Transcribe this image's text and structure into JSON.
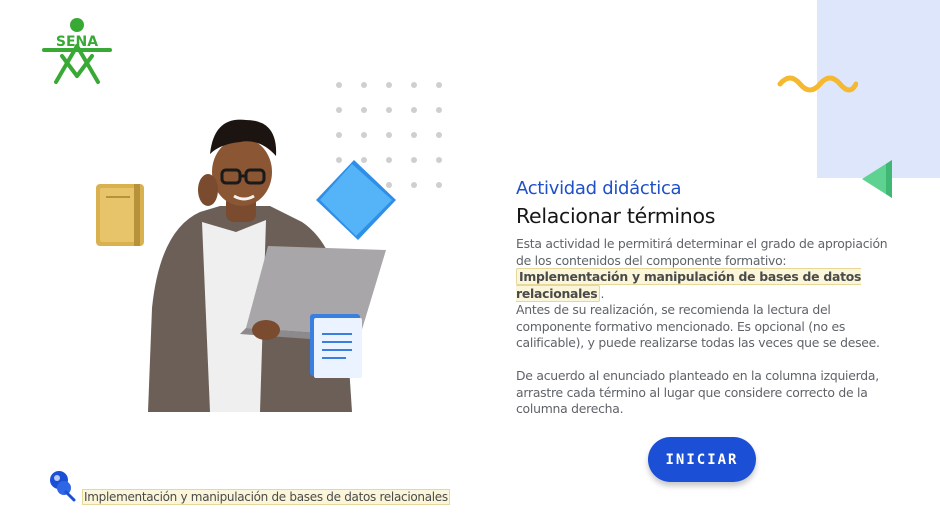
{
  "logo": {
    "text": "SENA"
  },
  "content": {
    "subtitle": "Actividad didáctica",
    "title": "Relacionar términos",
    "paragraph1": {
      "before": "Esta actividad le permitirá determinar el grado de apropiación de los contenidos del componente formativo: ",
      "highlight": "Implementación y manipulación de bases de datos relacionales",
      "after": "."
    },
    "paragraph2": "Antes de su realización, se recomienda la lectura del componente formativo mencionado.  Es opcional (no es calificable), y puede realizarse todas las veces que se desee.",
    "paragraph3": "De acuerdo al enunciado planteado en la columna izquierda, arrastre cada término al lugar que considere correcto de la columna derecha."
  },
  "button": {
    "label": "INICIAR"
  },
  "footer": {
    "label": "Implementación y manipulación de bases de datos relacionales"
  },
  "colors": {
    "accent_blue": "#1b4fd6",
    "sena_green": "#39a935",
    "highlight_bg": "#fbf6d9",
    "deco_yellow": "#f5b82e",
    "deco_lavender": "#dde6fb"
  },
  "icons": [
    "sena-logo-icon",
    "book-icon",
    "folder-icon",
    "document-icon",
    "pin-icon",
    "wave-decoration",
    "triangle-decoration"
  ]
}
